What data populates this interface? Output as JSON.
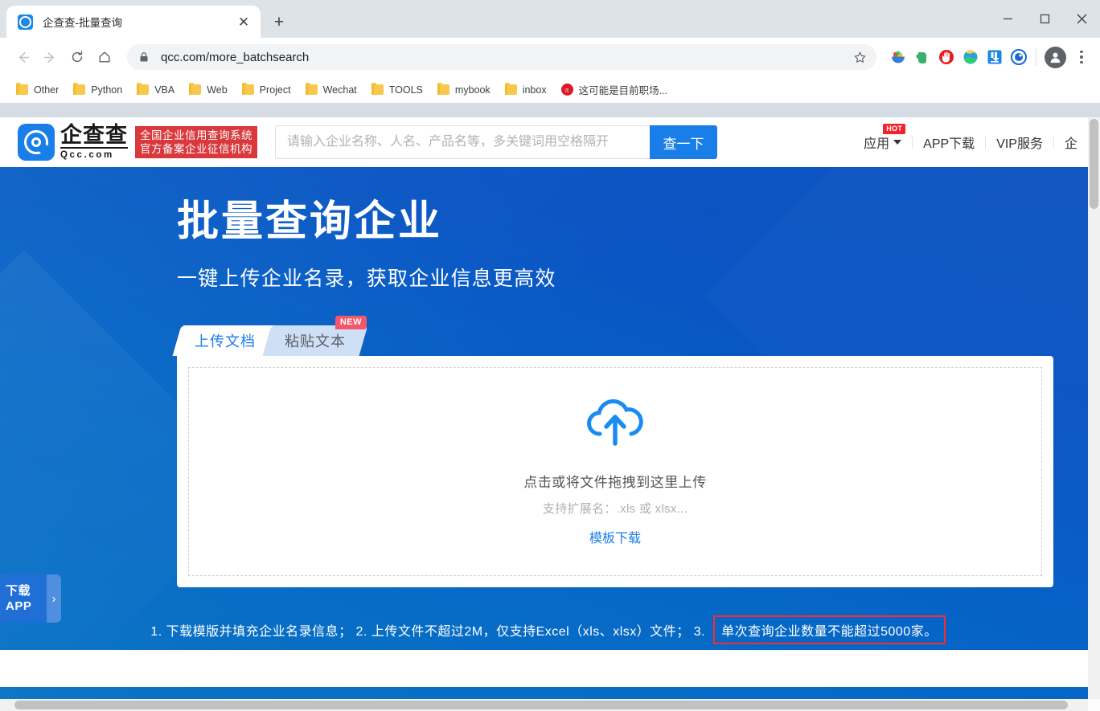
{
  "browser": {
    "tab": {
      "title": "企查查-批量查询",
      "favicon": "qcc-logo-icon",
      "close_label": "✕"
    },
    "new_tab_label": "+",
    "window_controls": {
      "minimize": "minimize-icon",
      "maximize": "maximize-icon",
      "close": "close-icon"
    },
    "nav": {
      "back": "←",
      "forward": "→",
      "reload": "⟳",
      "home": "⌂"
    },
    "omnibox": {
      "url": "qcc.com/more_batchsearch",
      "lock": "lock-icon",
      "star": "star-icon"
    },
    "extensions": [
      "fruit-bowl-icon",
      "evernote-icon",
      "adblock-icon",
      "idm-icon",
      "download-icon",
      "blue-circle-icon"
    ],
    "profile": "profile-avatar-icon",
    "menu": "three-dot-menu-icon",
    "bookmarks": [
      {
        "label": "Other",
        "type": "folder"
      },
      {
        "label": "Python",
        "type": "folder"
      },
      {
        "label": "VBA",
        "type": "folder"
      },
      {
        "label": "Web",
        "type": "folder"
      },
      {
        "label": "Project",
        "type": "folder"
      },
      {
        "label": "Wechat",
        "type": "folder"
      },
      {
        "label": "TOOLS",
        "type": "folder"
      },
      {
        "label": "mybook",
        "type": "folder"
      },
      {
        "label": "inbox",
        "type": "folder"
      },
      {
        "label": "这可能是目前职场...",
        "type": "link"
      }
    ]
  },
  "site": {
    "logo": {
      "cn": "企查查",
      "en": "Qcc.com",
      "badge_line1": "全国企业信用查询系统",
      "badge_line2": "官方备案企业征信机构"
    },
    "search": {
      "placeholder": "请输入企业名称、人名、产品名等，多关键词用空格隔开",
      "value": "",
      "button_label": "查一下"
    },
    "nav": [
      {
        "label": "应用",
        "badge": "HOT",
        "caret": true
      },
      {
        "label": "APP下载"
      },
      {
        "label": "VIP服务"
      },
      {
        "label": "企"
      }
    ]
  },
  "hero": {
    "title": "批量查询企业",
    "subtitle": "一键上传企业名录，获取企业信息更高效",
    "tabs": [
      {
        "label": "上传文档",
        "active": true
      },
      {
        "label": "粘贴文本",
        "active": false,
        "badge": "NEW"
      }
    ],
    "dropzone": {
      "icon": "cloud-upload-icon",
      "main_text": "点击或将文件拖拽到这里上传",
      "sub_text": "支持扩展名：.xls 或 xlsx...",
      "link_text": "模板下载"
    },
    "tips": {
      "plain": "1. 下载模版并填充企业名录信息； 2. 上传文件不超过2M，仅支持Excel（xls、xlsx）文件； 3.",
      "highlighted": "单次查询企业数量不能超过5000家。"
    }
  },
  "floating": {
    "app_widget": {
      "line1": "下载",
      "line2": "APP",
      "arrow": "›"
    }
  },
  "colors": {
    "brand_blue": "#1a7ee8",
    "hero_blue": "#0a5fc2",
    "badge_red": "#d9383c",
    "highlight_red": "#ff2a2a",
    "hot_red": "#f5222d",
    "new_pink": "#f5566b"
  }
}
